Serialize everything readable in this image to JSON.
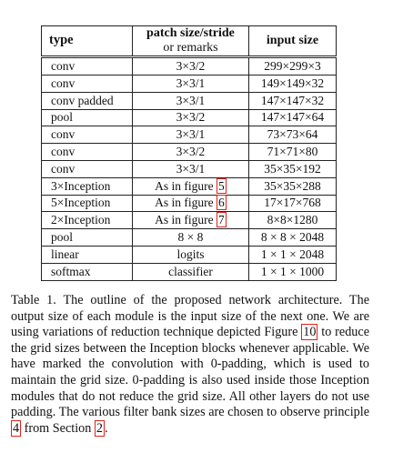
{
  "table": {
    "headers": [
      "type",
      "patch size/stride",
      "or remarks",
      "input size"
    ],
    "rows": [
      {
        "type": "conv",
        "patch": "3×3/2",
        "input": "299×299×3"
      },
      {
        "type": "conv",
        "patch": "3×3/1",
        "input": "149×149×32"
      },
      {
        "type": "conv padded",
        "patch": "3×3/1",
        "input": "147×147×32"
      },
      {
        "type": "pool",
        "patch": "3×3/2",
        "input": "147×147×64"
      },
      {
        "type": "conv",
        "patch": "3×3/1",
        "input": "73×73×64"
      },
      {
        "type": "conv",
        "patch": "3×3/2",
        "input": "71×71×80"
      },
      {
        "type": "conv",
        "patch": "3×3/1",
        "input": "35×35×192"
      },
      {
        "type": "3×Inception",
        "patch_prefix": "As in figure ",
        "patch_ref": "5",
        "input": "35×35×288"
      },
      {
        "type": "5×Inception",
        "patch_prefix": "As in figure ",
        "patch_ref": "6",
        "input": "17×17×768"
      },
      {
        "type": "2×Inception",
        "patch_prefix": "As in figure ",
        "patch_ref": "7",
        "input": "8×8×1280"
      },
      {
        "type": "pool",
        "patch": "8 × 8",
        "input": "8 × 8 × 2048"
      },
      {
        "type": "linear",
        "patch": "logits",
        "input": "1 × 1 × 2048"
      },
      {
        "type": "softmax",
        "patch": "classifier",
        "input": "1 × 1 × 1000"
      }
    ]
  },
  "caption": {
    "part1": "Table 1. The outline of the proposed network architecture.  The output size of each module is the input size of the next one.  We are using variations of reduction technique depicted Figure ",
    "ref_figure": "10",
    "part2": " to reduce the grid sizes between the Inception blocks whenever applicable. We have marked the convolution with 0-padding, which is used to maintain the grid size.  0-padding is also used inside those Inception modules that do not reduce the grid size. All other layers do not use padding. The various filter bank sizes are chosen to observe principle ",
    "ref_principle": "4",
    "part3": " from Section ",
    "ref_section": "2",
    "part4": "."
  },
  "ref_color": "#e0201a"
}
